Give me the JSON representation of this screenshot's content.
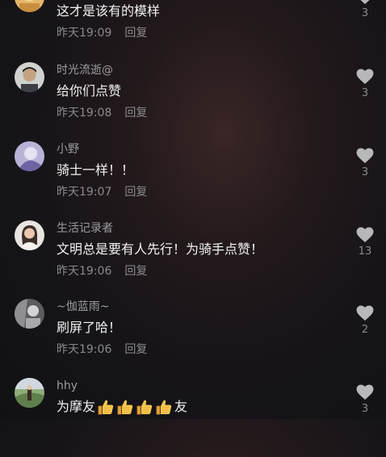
{
  "comments": [
    {
      "username": "",
      "text": "这才是该有的模样",
      "time": "昨天19:09",
      "reply_label": "回复",
      "likes": "3",
      "avatar_icon": "user-avatar-orange"
    },
    {
      "username": "时光流逝@",
      "text": "给你们点赞",
      "time": "昨天19:08",
      "reply_label": "回复",
      "likes": "3",
      "avatar_icon": "user-avatar-portrait"
    },
    {
      "username": "小野",
      "text": "骑士一样！！",
      "time": "昨天19:07",
      "reply_label": "回复",
      "likes": "3",
      "avatar_icon": "user-avatar-purple"
    },
    {
      "username": "生活记录者",
      "text": "文明总是要有人先行！为骑手点赞！",
      "time": "昨天19:06",
      "reply_label": "回复",
      "likes": "13",
      "avatar_icon": "user-avatar-woman"
    },
    {
      "username": "~伽蓝雨~",
      "text": "刷屏了哈！",
      "time": "昨天19:06",
      "reply_label": "回复",
      "likes": "2",
      "avatar_icon": "user-avatar-gray"
    },
    {
      "username": "hhy",
      "text_before": "为摩友",
      "thumbs_up_emoji_count": 4,
      "text_after": "友",
      "time": "",
      "reply_label": "",
      "likes": "3",
      "avatar_icon": "user-avatar-outdoor"
    }
  ],
  "colors": {
    "text_primary": "#f1f1f1",
    "text_secondary": "#8a8a8e",
    "heart": "#b8b8bc"
  }
}
